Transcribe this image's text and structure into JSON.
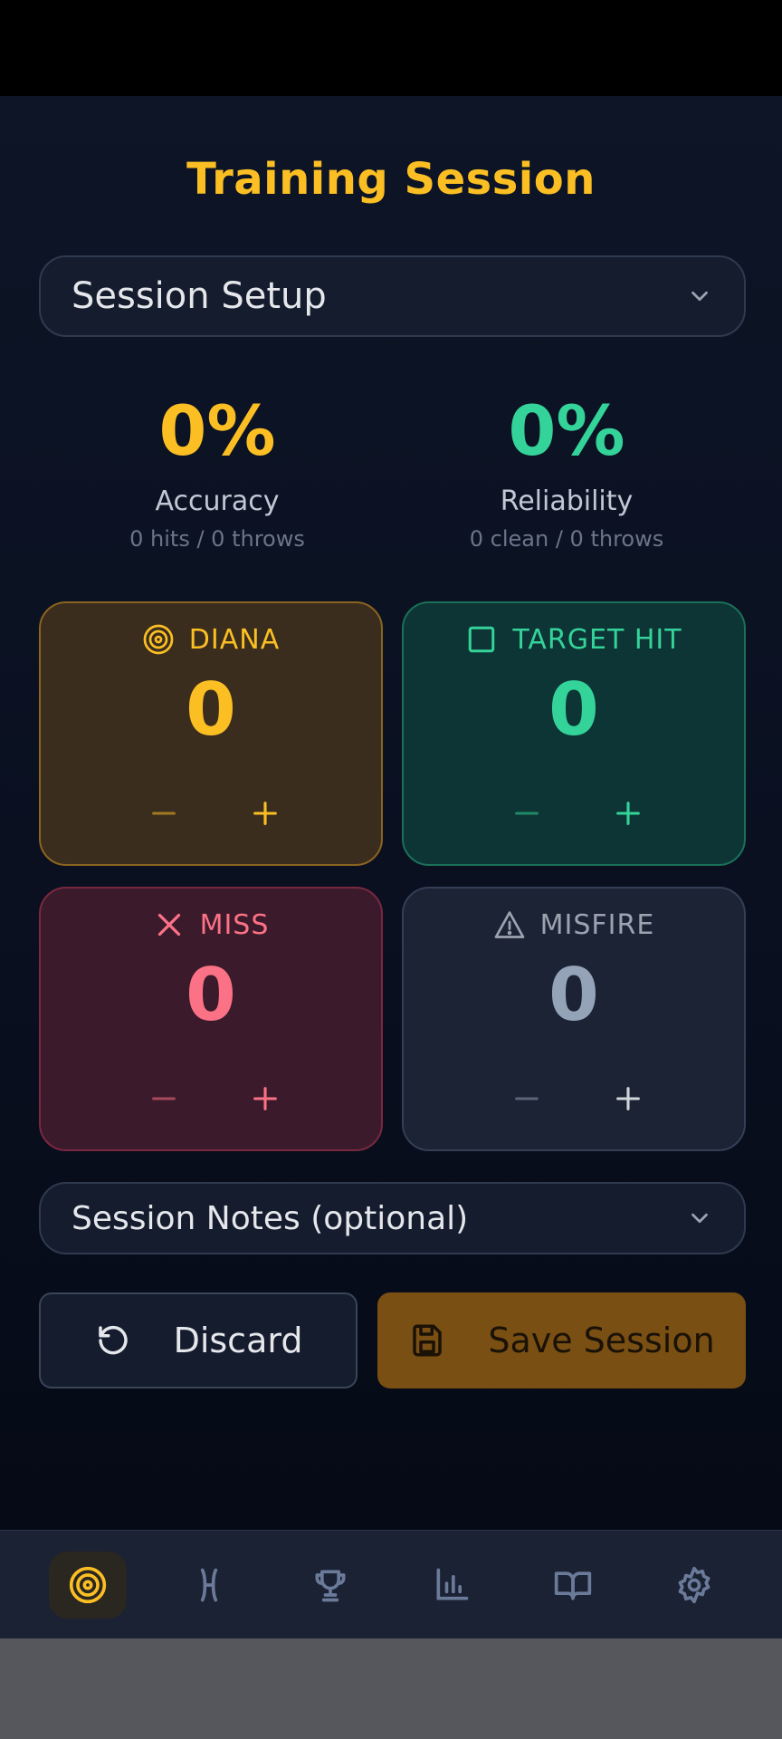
{
  "title": "Training Session",
  "setup": {
    "label": "Session Setup",
    "icon": "chevron-down-icon"
  },
  "stats": {
    "accuracy": {
      "value": "0%",
      "label": "Accuracy",
      "detail": "0 hits / 0 throws"
    },
    "reliability": {
      "value": "0%",
      "label": "Reliability",
      "detail": "0 clean / 0 throws"
    }
  },
  "counters": {
    "diana": {
      "label": "DIANA",
      "count": "0",
      "icon": "bullseye-icon",
      "color": "#fbbf24"
    },
    "target_hit": {
      "label": "TARGET HIT",
      "count": "0",
      "icon": "square-icon",
      "color": "#34d399"
    },
    "miss": {
      "label": "MISS",
      "count": "0",
      "icon": "x-icon",
      "color": "#fb7185"
    },
    "misfire": {
      "label": "MISFIRE",
      "count": "0",
      "icon": "warning-icon",
      "color": "#9ca3af"
    }
  },
  "notes": {
    "label": "Session Notes (optional)",
    "icon": "chevron-down-icon"
  },
  "actions": {
    "discard": {
      "label": "Discard",
      "icon": "undo-icon"
    },
    "save": {
      "label": "Save Session",
      "icon": "floppy-disk-icon"
    }
  },
  "nav": [
    {
      "name": "training",
      "icon": "bullseye-icon",
      "active": true
    },
    {
      "name": "equipment",
      "icon": "stand-icon",
      "active": false
    },
    {
      "name": "achievements",
      "icon": "trophy-icon",
      "active": false
    },
    {
      "name": "stats",
      "icon": "bar-chart-icon",
      "active": false
    },
    {
      "name": "guide",
      "icon": "book-icon",
      "active": false
    },
    {
      "name": "settings",
      "icon": "gear-icon",
      "active": false
    }
  ],
  "colors": {
    "accent": "#fbbf24",
    "success": "#34d399",
    "danger": "#fb7185",
    "background": "#0b1222"
  }
}
